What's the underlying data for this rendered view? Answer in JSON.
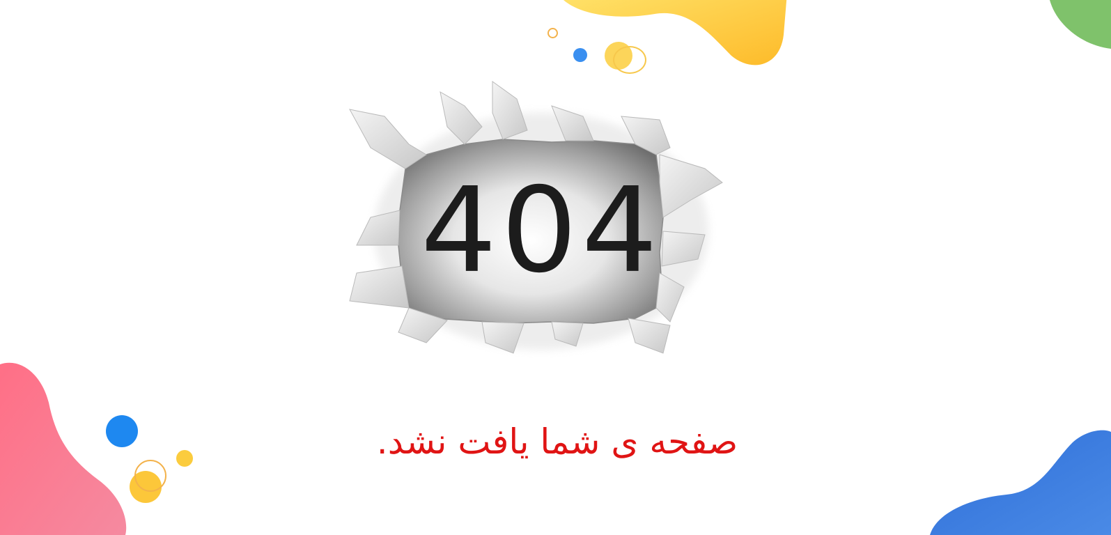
{
  "error": {
    "code": "404",
    "message": "صفحه ی شما یافت نشد."
  },
  "colors": {
    "message": "#e01414",
    "code": "#1c1c1c",
    "blob_yellow": "#fdc93a",
    "blob_green": "#7fc26b",
    "blob_pink": "#f47a8e",
    "blob_blue": "#3d7fe0",
    "dot_blue": "#1e88f0",
    "dot_yellow": "#fbcc3e",
    "ring_orange": "#f3b24b"
  },
  "illustration": "torn-paper-hole"
}
